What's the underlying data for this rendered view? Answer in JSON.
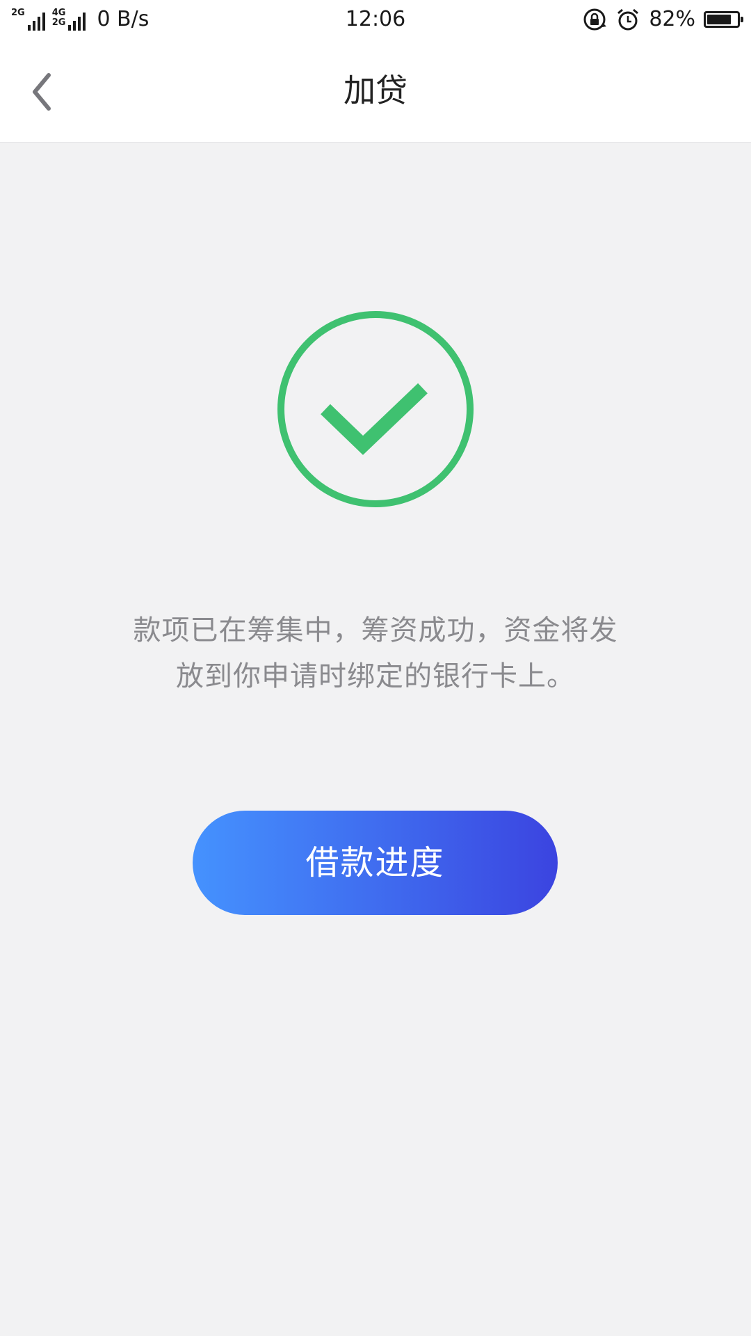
{
  "status_bar": {
    "sim1_label": "2G",
    "sim2_label_top": "4G",
    "sim2_label_bottom": "2G",
    "network_speed": "0 B/s",
    "time": "12:06",
    "battery_percent": "82%",
    "battery_level": 0.82
  },
  "header": {
    "title": "加贷"
  },
  "main": {
    "message_line1": "款项已在筹集中，筹资成功，资金将发",
    "message_line2": "放到你申请时绑定的银行卡上。",
    "button_label": "借款进度"
  },
  "colors": {
    "success_green": "#3fc170",
    "button_gradient_start": "#4592fe",
    "button_gradient_end": "#3b44e0",
    "background": "#f2f2f3",
    "message_text": "#8a8a8e"
  }
}
